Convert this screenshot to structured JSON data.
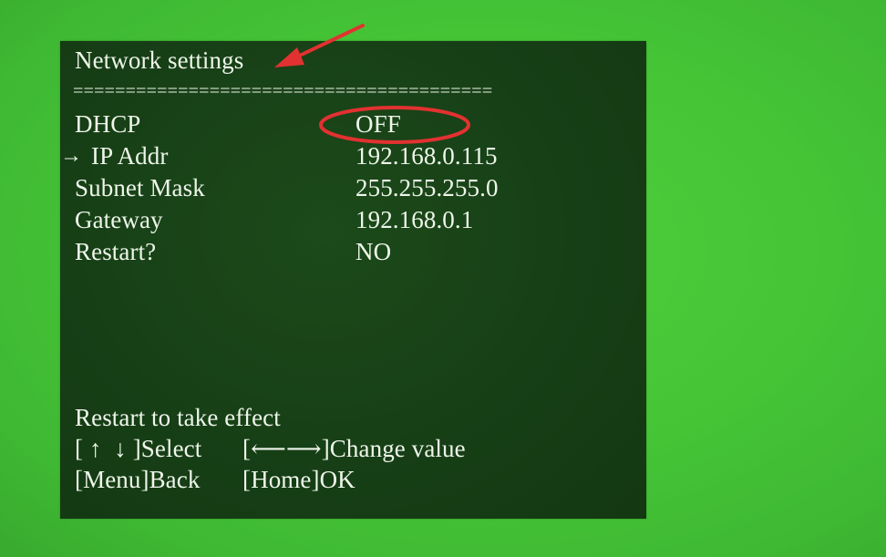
{
  "screen": {
    "title": "Network settings",
    "separator": "========================================",
    "rows": [
      {
        "label": "DHCP",
        "value": "OFF"
      },
      {
        "label": "IP Addr",
        "value": "192.168.0.115"
      },
      {
        "label": "Subnet Mask",
        "value": "255.255.255.0"
      },
      {
        "label": "Gateway",
        "value": "192.168.0.1"
      },
      {
        "label": "Restart?",
        "value": "NO"
      }
    ],
    "selected_row_indicator": "→",
    "selected_row": "IP Addr",
    "footer": {
      "note": "Restart to take effect",
      "select_hint": "[ ↑  ↓ ]Select",
      "change_hint": "[⟵⟶]Change value",
      "back_hint": "[Menu]Back",
      "ok_hint": "[Home]OK"
    }
  },
  "annotations": {
    "arrow_color": "#e23131",
    "circle_color": "#e23131"
  }
}
